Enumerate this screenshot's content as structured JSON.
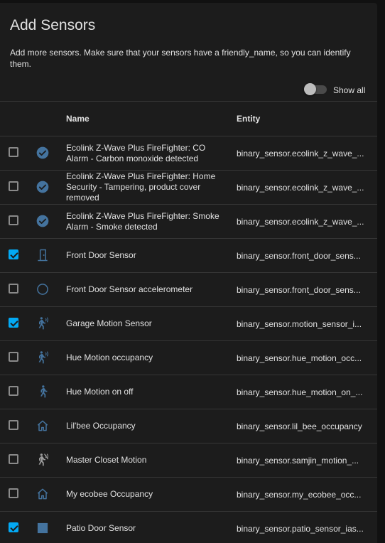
{
  "dialog": {
    "title": "Add Sensors",
    "description": "Add more sensors. Make sure that your sensors have a friendly_name, so you can identify them.",
    "show_all_label": "Show all",
    "show_all": false
  },
  "table": {
    "columns": {
      "name": "Name",
      "entity": "Entity"
    },
    "rows": [
      {
        "checked": false,
        "icon": "check-circle-icon",
        "name": "Ecolink Z-Wave Plus FireFighter: CO Alarm - Carbon monoxide detected",
        "entity": "binary_sensor.ecolink_z_wave_..."
      },
      {
        "checked": false,
        "icon": "check-circle-icon",
        "name": "Ecolink Z-Wave Plus FireFighter: Home Security - Tampering, product cover removed",
        "entity": "binary_sensor.ecolink_z_wave_..."
      },
      {
        "checked": false,
        "icon": "check-circle-icon",
        "name": "Ecolink Z-Wave Plus FireFighter: Smoke Alarm - Smoke detected",
        "entity": "binary_sensor.ecolink_z_wave_..."
      },
      {
        "checked": true,
        "icon": "door-closed-icon",
        "name": "Front Door Sensor",
        "entity": "binary_sensor.front_door_sens..."
      },
      {
        "checked": false,
        "icon": "circle-outline-icon",
        "name": "Front Door Sensor accelerometer",
        "entity": "binary_sensor.front_door_sens..."
      },
      {
        "checked": true,
        "icon": "motion-sensor-icon",
        "name": "Garage Motion Sensor",
        "entity": "binary_sensor.motion_sensor_i..."
      },
      {
        "checked": false,
        "icon": "motion-sensor-icon",
        "name": "Hue Motion occupancy",
        "entity": "binary_sensor.hue_motion_occ..."
      },
      {
        "checked": false,
        "icon": "walk-icon",
        "name": "Hue Motion on off",
        "entity": "binary_sensor.hue_motion_on_..."
      },
      {
        "checked": false,
        "icon": "home-outline-icon",
        "name": "Lil'bee Occupancy",
        "entity": "binary_sensor.lil_bee_occupancy"
      },
      {
        "checked": false,
        "icon": "motion-sensor-off-icon",
        "name": "Master Closet Motion",
        "entity": "binary_sensor.samjin_motion_..."
      },
      {
        "checked": false,
        "icon": "home-outline-icon",
        "name": "My ecobee Occupancy",
        "entity": "binary_sensor.my_ecobee_occ..."
      },
      {
        "checked": true,
        "icon": "square-icon",
        "name": "Patio Door Sensor",
        "entity": "binary_sensor.patio_sensor_ias..."
      }
    ]
  },
  "colors": {
    "accent": "#03a9f4",
    "icon": "#44739e",
    "icon_off": "#9e9e9e"
  }
}
